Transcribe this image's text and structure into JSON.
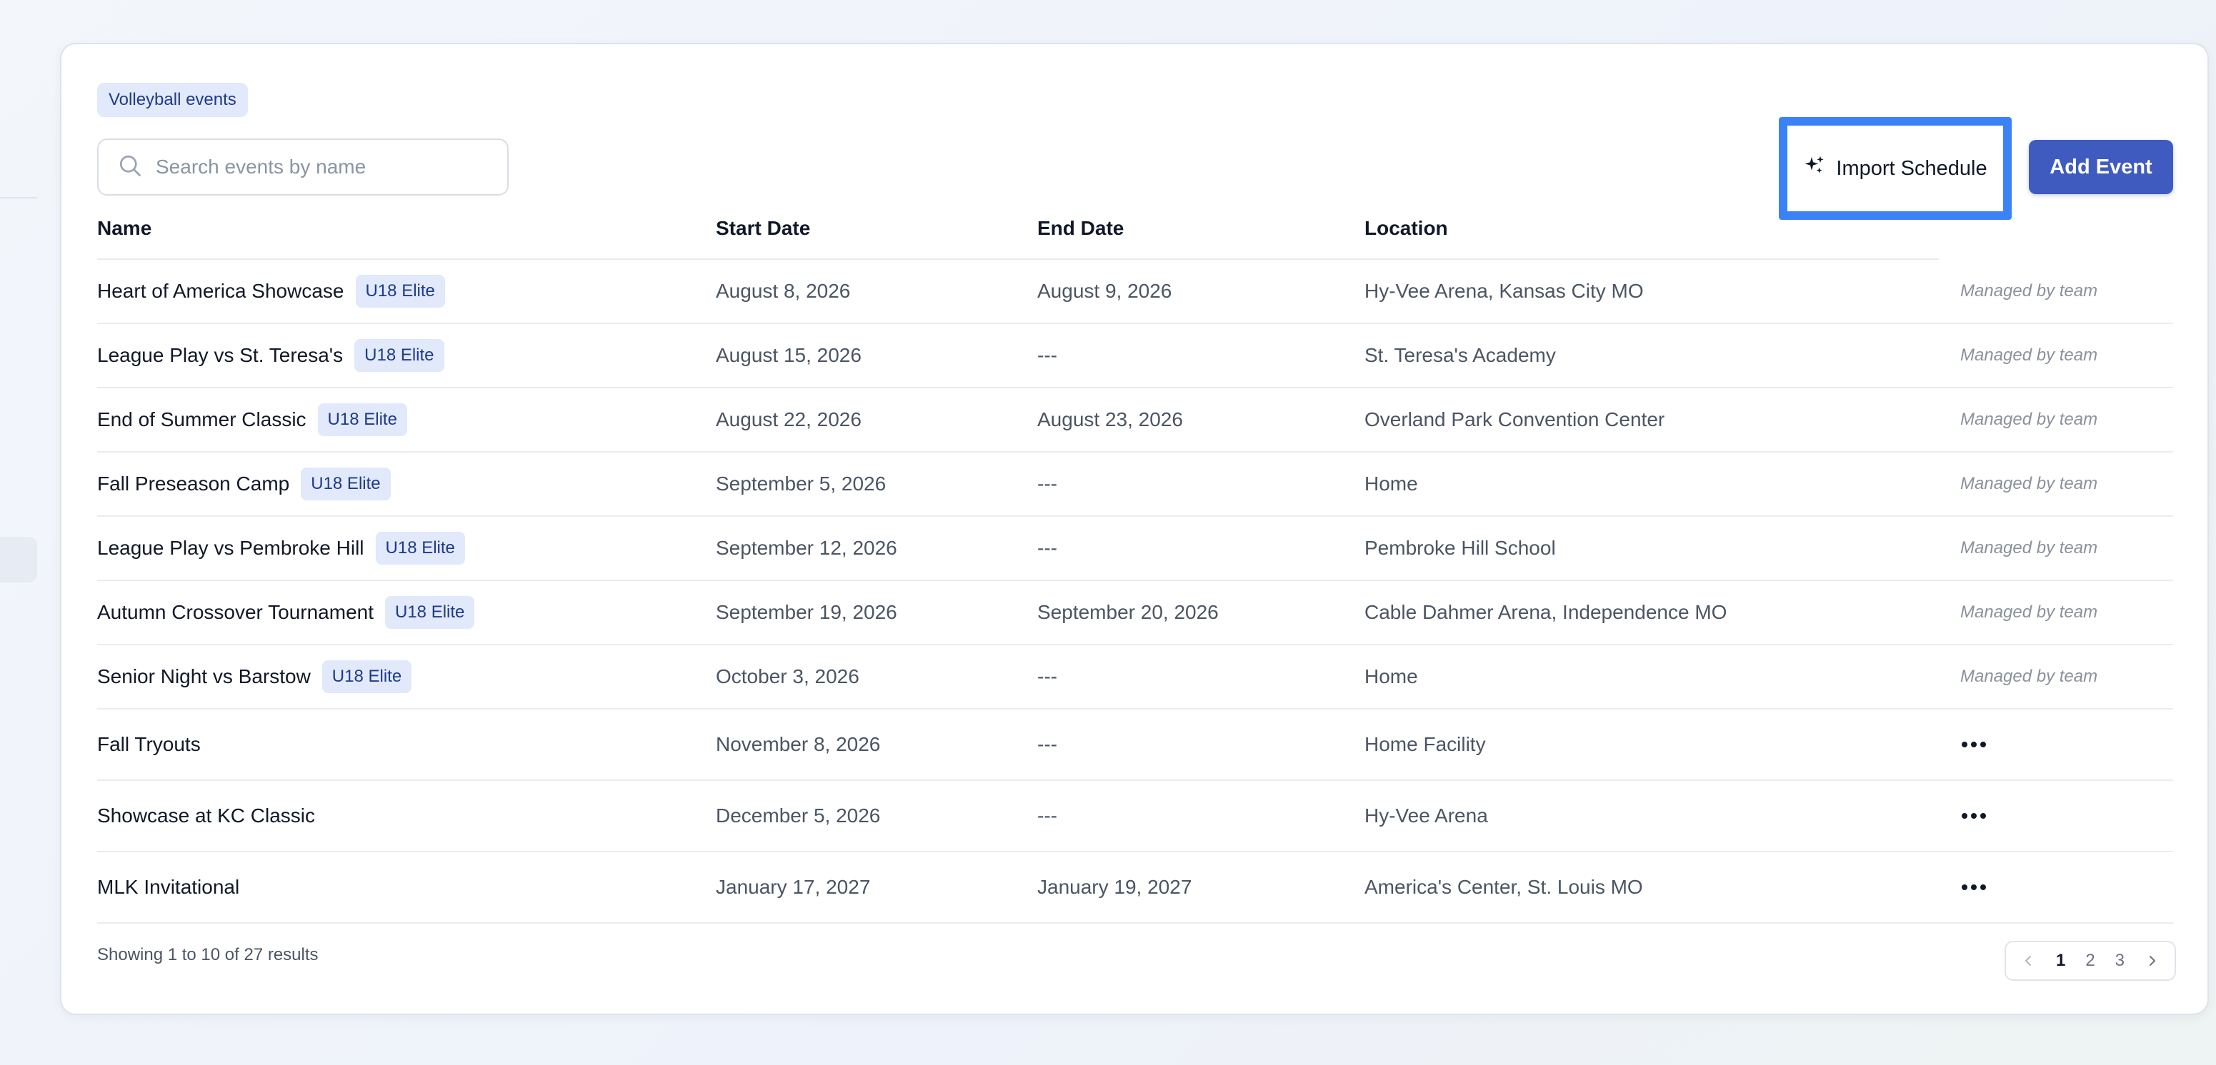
{
  "filter_chip": "Volleyball events",
  "search": {
    "placeholder": "Search events by name"
  },
  "toolbar": {
    "import_label": "Import Schedule",
    "add_label": "Add Event"
  },
  "columns": {
    "name": "Name",
    "start": "Start Date",
    "end": "End Date",
    "location": "Location"
  },
  "rows": [
    {
      "name": "Heart of America Showcase",
      "tag": "U18 Elite",
      "start": "August 8, 2026",
      "end": "August 9, 2026",
      "location": "Hy-Vee Arena, Kansas City MO",
      "status": "Managed by team"
    },
    {
      "name": "League Play vs St. Teresa's",
      "tag": "U18 Elite",
      "start": "August 15, 2026",
      "end": "---",
      "location": "St. Teresa's Academy",
      "status": "Managed by team"
    },
    {
      "name": "End of Summer Classic",
      "tag": "U18 Elite",
      "start": "August 22, 2026",
      "end": "August 23, 2026",
      "location": "Overland Park Convention Center",
      "status": "Managed by team"
    },
    {
      "name": "Fall Preseason Camp",
      "tag": "U18 Elite",
      "start": "September 5, 2026",
      "end": "---",
      "location": "Home",
      "status": "Managed by team"
    },
    {
      "name": "League Play vs Pembroke Hill",
      "tag": "U18 Elite",
      "start": "September 12, 2026",
      "end": "---",
      "location": "Pembroke Hill School",
      "status": "Managed by team"
    },
    {
      "name": "Autumn Crossover Tournament",
      "tag": "U18 Elite",
      "start": "September 19, 2026",
      "end": "September 20, 2026",
      "location": "Cable Dahmer Arena, Independence MO",
      "status": "Managed by team"
    },
    {
      "name": "Senior Night vs Barstow",
      "tag": "U18 Elite",
      "start": "October 3, 2026",
      "end": "---",
      "location": "Home",
      "status": "Managed by team"
    },
    {
      "name": "Fall Tryouts",
      "start": "November 8, 2026",
      "end": "---",
      "location": "Home Facility"
    },
    {
      "name": "Showcase at KC Classic",
      "start": "December 5, 2026",
      "end": "---",
      "location": "Hy-Vee Arena"
    },
    {
      "name": "MLK Invitational",
      "start": "January 17, 2027",
      "end": "January 19, 2027",
      "location": "America's Center, St. Louis MO"
    }
  ],
  "footer": {
    "summary": "Showing 1 to 10 of 27 results"
  },
  "pagination": {
    "pages": [
      "1",
      "2",
      "3"
    ],
    "current": "1"
  },
  "icons": {
    "search": "search-icon",
    "import": "sparkles-icon",
    "more": "more-horizontal-icon",
    "prev": "chevron-left-icon",
    "next": "chevron-right-icon"
  },
  "colors": {
    "primary": "#3f5bbf",
    "highlight": "#3b82f6",
    "tag_bg": "#e1e9fb",
    "tag_text": "#1e3a8a"
  }
}
